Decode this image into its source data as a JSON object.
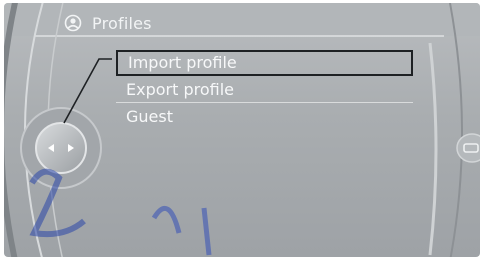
{
  "header": {
    "title": "Profiles",
    "icon": "profile-icon"
  },
  "menu": {
    "items": [
      {
        "label": "Import profile",
        "selected": true
      },
      {
        "label": "Export profile",
        "selected": false
      },
      {
        "label": "Guest",
        "selected": false
      }
    ]
  },
  "controller": {
    "icon": "controller-arrows-icon"
  },
  "side_button": {
    "icon": "options-icon"
  },
  "colors": {
    "screen": "#a9adb0",
    "text": "#f7f8f9",
    "selection_border": "#1e2124"
  }
}
